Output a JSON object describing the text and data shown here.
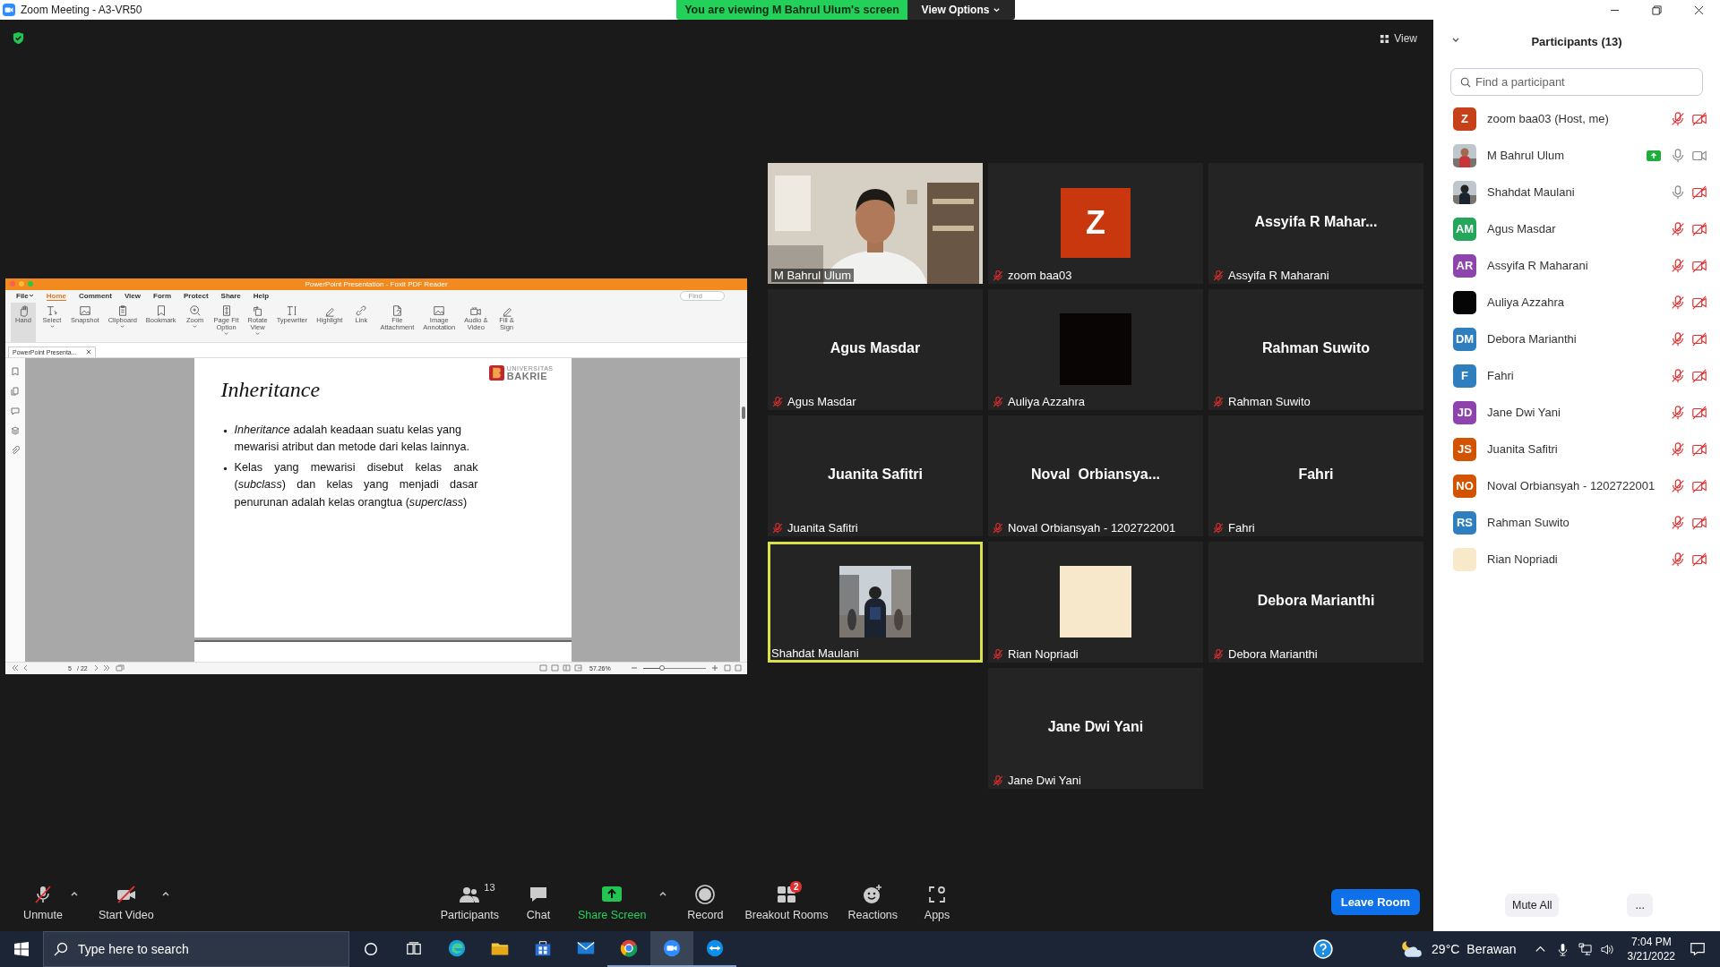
{
  "window": {
    "title": "Zoom Meeting - A3-VR50",
    "banner": "You are viewing M Bahrul Ulum's screen",
    "view_options": "View Options"
  },
  "view_button": "View",
  "shared_screen": {
    "title": "PowerPoint Presentation - Foxit PDF Reader",
    "menu": [
      {
        "label": "File",
        "selected": false,
        "dropdown": true
      },
      {
        "label": "Home",
        "selected": true,
        "dropdown": false
      },
      {
        "label": "Comment",
        "selected": false,
        "dropdown": false
      },
      {
        "label": "View",
        "selected": false,
        "dropdown": false
      },
      {
        "label": "Form",
        "selected": false,
        "dropdown": false
      },
      {
        "label": "Protect",
        "selected": false,
        "dropdown": false
      },
      {
        "label": "Share",
        "selected": false,
        "dropdown": false
      },
      {
        "label": "Help",
        "selected": false,
        "dropdown": false
      }
    ],
    "find_placeholder": "Find",
    "tools": [
      {
        "label": "Hand",
        "selected": true,
        "dropdown": false
      },
      {
        "label": "Select",
        "selected": false,
        "dropdown": true
      },
      {
        "label": "Snapshot",
        "selected": false,
        "dropdown": false
      },
      {
        "label": "Clipboard",
        "selected": false,
        "dropdown": true
      },
      {
        "label": "Bookmark",
        "selected": false,
        "dropdown": false
      },
      {
        "label": "Zoom",
        "selected": false,
        "dropdown": true
      },
      {
        "label": "Page Fit\nOption",
        "selected": false,
        "dropdown": true
      },
      {
        "label": "Rotate\nView",
        "selected": false,
        "dropdown": true
      },
      {
        "label": "Typewriter",
        "selected": false,
        "dropdown": false
      },
      {
        "label": "Highlight",
        "selected": false,
        "dropdown": false
      },
      {
        "label": "Link",
        "selected": false,
        "dropdown": false
      },
      {
        "label": "File\nAttachment",
        "selected": false,
        "dropdown": false
      },
      {
        "label": "Image\nAnnotation",
        "selected": false,
        "dropdown": false
      },
      {
        "label": "Audio &\nVideo",
        "selected": false,
        "dropdown": false
      },
      {
        "label": "Fill &\nSign",
        "selected": false,
        "dropdown": false
      }
    ],
    "doc_tab": "PowerPoint Presenta...",
    "slide": {
      "title": "Inheritance",
      "logo_small": "UNIVERSITAS",
      "logo_big": "BAKRIE",
      "bullets": [
        "*Inheritance* adalah keadaan suatu kelas yang mewarisi atribut dan metode dari kelas lainnya.",
        "Kelas yang mewarisi disebut kelas anak (*subclass*) dan kelas yang menjadi dasar penurunan adalah kelas orangtua (*superclass*)"
      ]
    },
    "page": "5",
    "page_total": "/ 22",
    "zoom": "57.26%",
    "zoom_slider": {
      "level": 0.3
    }
  },
  "tiles": [
    {
      "kind": "video",
      "label": "M Bahrul Ulum",
      "muted": false,
      "active": false
    },
    {
      "kind": "initial",
      "initial": "Z",
      "color": "#c9370f",
      "label": "zoom baa03",
      "muted": true,
      "active": false
    },
    {
      "kind": "name",
      "display": "Assyifa R Mahar...",
      "label": "Assyifa R Maharani",
      "muted": true,
      "active": false
    },
    {
      "kind": "name",
      "display": "Agus Masdar",
      "label": "Agus Masdar",
      "muted": true,
      "active": false
    },
    {
      "kind": "square",
      "color": "#0a0505",
      "label": "Auliya Azzahra",
      "muted": true,
      "active": false
    },
    {
      "kind": "name",
      "display": "Rahman Suwito",
      "label": "Rahman Suwito",
      "muted": true,
      "active": false
    },
    {
      "kind": "name",
      "display": "Juanita Safitri",
      "label": "Juanita Safitri",
      "muted": true,
      "active": false
    },
    {
      "kind": "name",
      "display": "Noval  Orbiansya...",
      "label": "Noval Orbiansyah - 1202722001",
      "muted": true,
      "active": false
    },
    {
      "kind": "name",
      "display": "Fahri",
      "label": "Fahri",
      "muted": true,
      "active": false
    },
    {
      "label": "Shahdat Maulani",
      "muted": false,
      "active": true
    },
    {
      "kind": "square",
      "color": "#f8e8cb",
      "label": "Rian Nopriadi",
      "muted": true,
      "active": false
    },
    {
      "kind": "name",
      "display": "Debora Marianthi",
      "label": "Debora Marianthi",
      "muted": true,
      "active": false
    },
    {
      "kind": "name",
      "display": "Jane Dwi Yani",
      "label": "Jane Dwi Yani",
      "muted": true,
      "active": false
    }
  ],
  "toolbar": {
    "left_items": [
      {
        "label": "Unmute",
        "caret": true
      },
      {
        "label": "Start Video",
        "caret": true
      }
    ],
    "center_items": [
      {
        "label": "Participants",
        "count": "13",
        "caret": false,
        "accent": false
      },
      {
        "label": "Chat",
        "caret": false,
        "accent": false
      },
      {
        "label": "Share Screen",
        "caret": true,
        "accent": true
      },
      {
        "label": "Record",
        "caret": false,
        "accent": false
      },
      {
        "label": "Breakout Rooms",
        "badge": "2",
        "caret": false,
        "accent": false
      },
      {
        "label": "Reactions",
        "caret": false,
        "accent": false
      },
      {
        "label": "Apps",
        "caret": false,
        "accent": false
      }
    ],
    "leave": "Leave Room"
  },
  "participants": {
    "title": "Participants (13)",
    "search_placeholder": "Find a participant",
    "items": [
      {
        "name": "zoom baa03 (Host, me)",
        "kind": "initials",
        "initials": "Z",
        "color": "#c6401a",
        "muted": true,
        "video_on": false,
        "sharing": false
      },
      {
        "name": "M Bahrul Ulum",
        "muted": false,
        "video_on": true,
        "sharing": true
      },
      {
        "name": "Shahdat Maulani",
        "muted": false,
        "video_on": false,
        "sharing": false
      },
      {
        "name": "Agus Masdar",
        "kind": "initials",
        "initials": "AM",
        "color": "#24a75a",
        "muted": true,
        "video_on": false,
        "sharing": false
      },
      {
        "name": "Assyifa R Maharani",
        "kind": "initials",
        "initials": "AR",
        "color": "#8e44ad",
        "muted": true,
        "video_on": false,
        "sharing": false
      },
      {
        "name": "Auliya Azzahra",
        "kind": "color",
        "color": "#050505",
        "muted": true,
        "video_on": false,
        "sharing": false
      },
      {
        "name": "Debora Marianthi",
        "kind": "initials",
        "initials": "DM",
        "color": "#2f7fc0",
        "muted": true,
        "video_on": false,
        "sharing": false
      },
      {
        "name": "Fahri",
        "kind": "initials",
        "initials": "F",
        "color": "#2f7fc0",
        "muted": true,
        "video_on": false,
        "sharing": false
      },
      {
        "name": "Jane Dwi Yani",
        "kind": "initials",
        "initials": "JD",
        "color": "#8e44ad",
        "muted": true,
        "video_on": false,
        "sharing": false
      },
      {
        "name": "Juanita Safitri",
        "kind": "initials",
        "initials": "JS",
        "color": "#d35400",
        "muted": true,
        "video_on": false,
        "sharing": false
      },
      {
        "name": "Noval Orbiansyah - 1202722001",
        "kind": "initials",
        "initials": "NO",
        "color": "#d35400",
        "muted": true,
        "video_on": false,
        "sharing": false
      },
      {
        "name": "Rahman Suwito",
        "kind": "initials",
        "initials": "RS",
        "color": "#2f7fc0",
        "muted": true,
        "video_on": false,
        "sharing": false
      },
      {
        "name": "Rian Nopriadi",
        "kind": "color",
        "color": "#f9e9cb",
        "muted": true,
        "video_on": false,
        "sharing": false
      }
    ],
    "mute_all": "Mute All",
    "more": "..."
  },
  "taskbar": {
    "search_placeholder": "Type here to search",
    "apps": [
      {
        "running": false,
        "selected": false
      },
      {
        "running": false,
        "selected": false
      },
      {
        "running": false,
        "selected": false
      },
      {
        "running": false,
        "selected": false
      },
      {
        "running": true,
        "selected": false
      },
      {
        "running": true,
        "selected": true
      },
      {
        "running": true,
        "selected": false
      }
    ],
    "temperature": "29°C",
    "weather": "Berawan",
    "time": "7:04 PM",
    "date": "3/21/2022"
  }
}
